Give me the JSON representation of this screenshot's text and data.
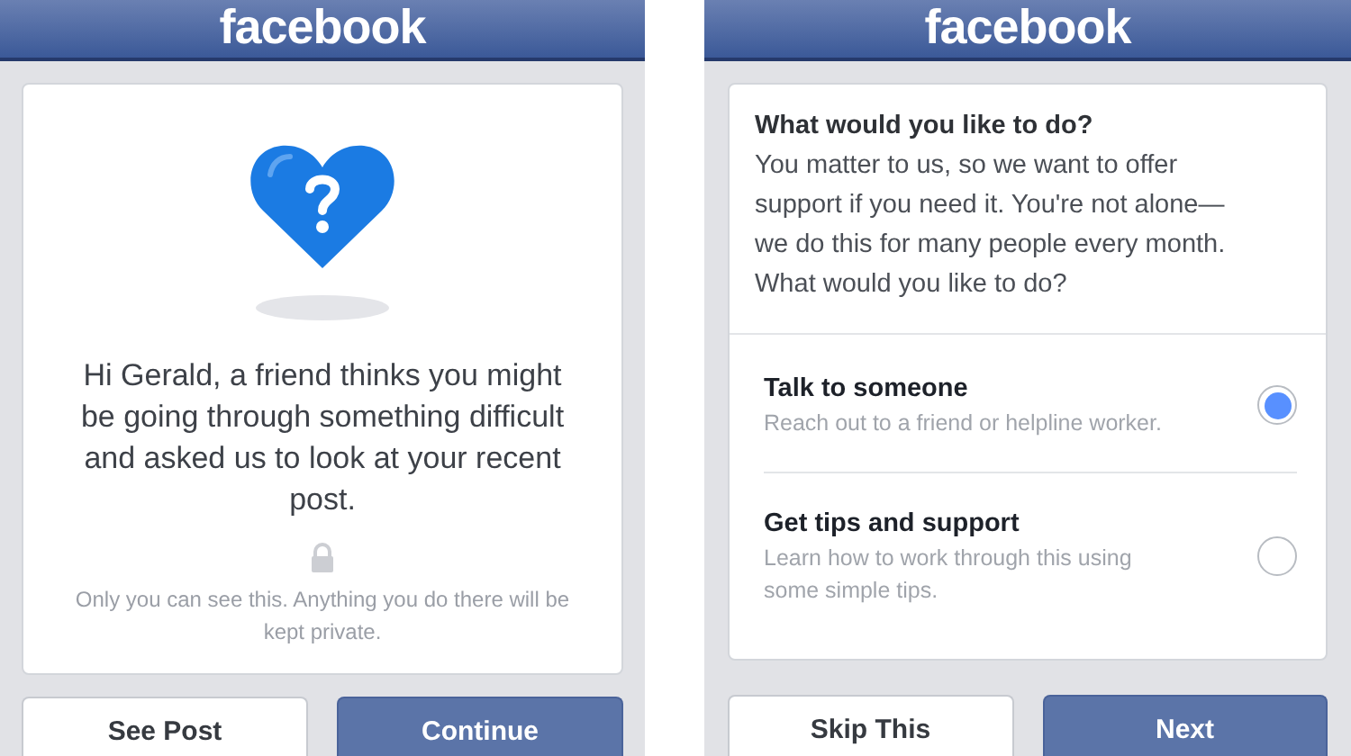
{
  "screens": [
    {
      "kind": "prompt",
      "logo": "facebook",
      "message": "Hi Gerald, a friend thinks you might be going through something difficult and asked us to look at your recent post.",
      "privacy_note": "Only you can see this. Anything you do there will be kept private.",
      "buttons": [
        {
          "label": "See Post",
          "primary": false
        },
        {
          "label": "Continue",
          "primary": true
        }
      ]
    },
    {
      "kind": "options",
      "logo": "facebook",
      "heading": "What would you like to do?",
      "intro": "You matter to us, so we want to offer support if you need it. You're not alone— we do this for many people every month. What would you like to do?",
      "options": [
        {
          "title": "Talk to someone",
          "description": "Reach out to a friend or helpline worker.",
          "selected": true
        },
        {
          "title": "Get tips and support",
          "description": "Learn how to work through this using some simple tips.",
          "selected": false
        }
      ],
      "buttons": [
        {
          "label": "Skip This",
          "primary": false
        },
        {
          "label": "Next",
          "primary": true
        }
      ]
    }
  ]
}
